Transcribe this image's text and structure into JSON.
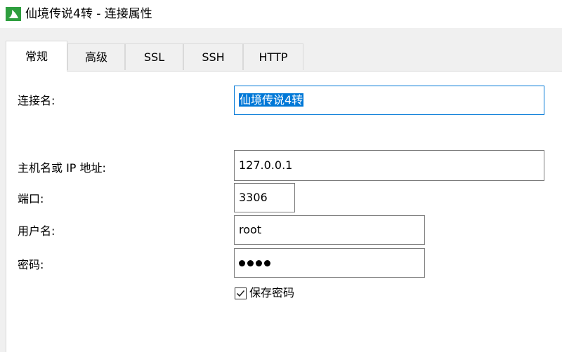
{
  "window": {
    "title": "仙境传说4转 - 连接属性"
  },
  "tabs": [
    {
      "label": "常规",
      "active": true
    },
    {
      "label": "高级",
      "active": false
    },
    {
      "label": "SSL",
      "active": false
    },
    {
      "label": "SSH",
      "active": false
    },
    {
      "label": "HTTP",
      "active": false
    }
  ],
  "form": {
    "connection_name_label": "连接名:",
    "connection_name_value": "仙境传说4转",
    "host_label": "主机名或 IP 地址:",
    "host_value": "127.0.0.1",
    "port_label": "端口:",
    "port_value": "3306",
    "username_label": "用户名:",
    "username_value": "root",
    "password_label": "密码:",
    "password_mask_count": 4,
    "save_password_label": "保存密码",
    "save_password_checked": true
  },
  "colors": {
    "selection": "#0078d7",
    "icon_green": "#2e9e3e"
  },
  "icons": {
    "app": "navicat-leaf-icon",
    "checkbox": "checkmark-icon"
  }
}
